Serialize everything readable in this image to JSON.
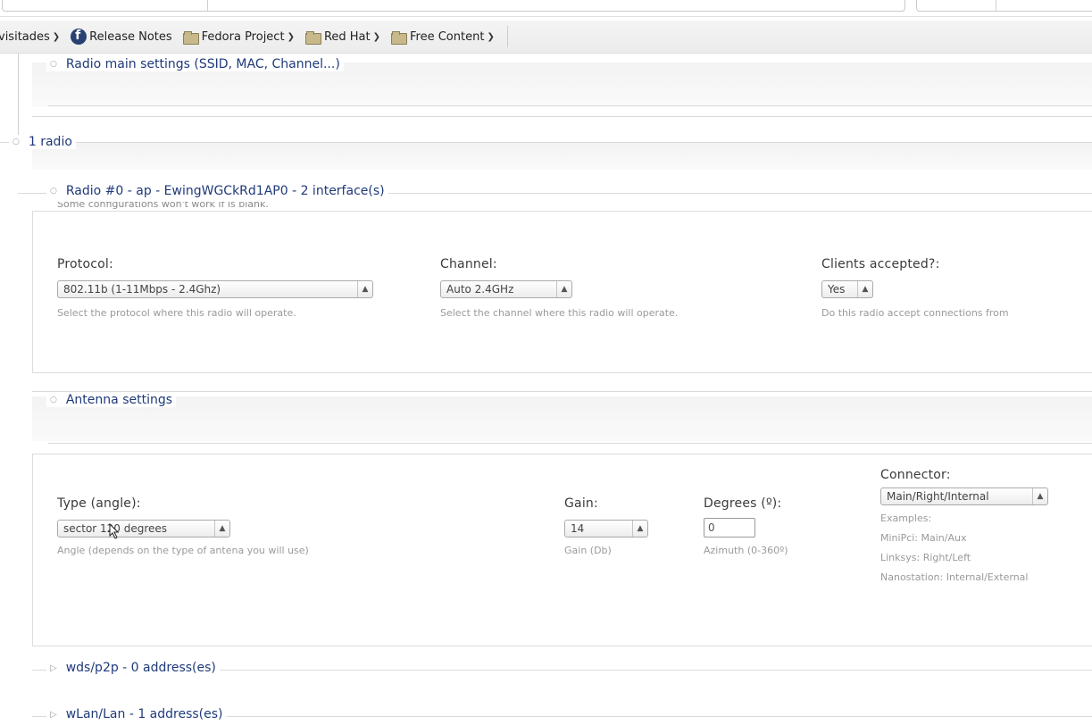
{
  "bookmarks": {
    "items": [
      {
        "label": "visitades",
        "icon": "none"
      },
      {
        "label": "Release Notes",
        "icon": "fedora-icon"
      },
      {
        "label": "Fedora Project",
        "icon": "folder-icon"
      },
      {
        "label": "Red Hat",
        "icon": "folder-icon"
      },
      {
        "label": "Free Content",
        "icon": "folder-icon"
      }
    ]
  },
  "sections": {
    "radio_main": "Radio main settings (SSID, MAC, Channel...)",
    "radios_count": "1 radio",
    "radio0": "Radio #0 - ap - EwingWGCkRd1AP0 - 2 interface(s)",
    "cutoff_text": "Some configurations won't work if is blank.",
    "antenna": "Antenna settings",
    "wds": "wds/p2p - 0 address(es)",
    "wlan": "wLan/Lan - 1 address(es)"
  },
  "radio": {
    "protocol": {
      "label": "Protocol:",
      "value": "802.11b (1-11Mbps - 2.4Ghz)",
      "help": "Select the protocol where this radio will operate."
    },
    "channel": {
      "label": "Channel:",
      "value": "Auto 2.4GHz",
      "help": "Select the channel where this radio will operate."
    },
    "clients": {
      "label": "Clients accepted?:",
      "value": "Yes",
      "help": "Do this radio accept connections from"
    }
  },
  "antenna": {
    "type": {
      "label": "Type (angle):",
      "value": "sector 120 degrees",
      "help": "Angle (depends on the type of antena you will use)"
    },
    "gain": {
      "label": "Gain:",
      "value": "14",
      "help": "Gain (Db)"
    },
    "degrees": {
      "label": "Degrees (º):",
      "value": "0",
      "help": "Azimuth (0-360º)"
    },
    "connector": {
      "label": "Connector:",
      "value": "Main/Right/Internal",
      "examples": [
        "Examples:",
        "MiniPci: Main/Aux",
        "Linksys: Right/Left",
        "Nanostation: Internal/External"
      ]
    }
  },
  "colors": {
    "legend": "#1f3a7a",
    "help": "#9a9a9a",
    "label": "#3a3a3a"
  }
}
